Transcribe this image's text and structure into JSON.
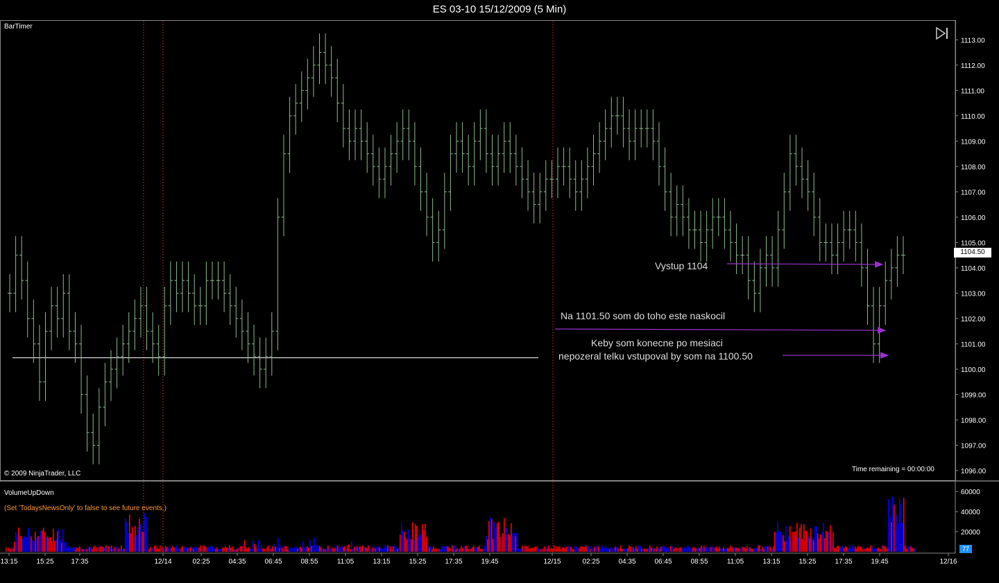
{
  "window": {
    "title": "ES 03-10  15/12/2009 (5 Min)"
  },
  "price_panel": {
    "indicator_label": "BarTimer",
    "copyright": "© 2009 NinjaTrader, LLC",
    "time_remaining": "Time remaining = 00:00:00",
    "last_price_label": "1104.50",
    "play_icon": "skip-forward-icon"
  },
  "volume_panel": {
    "indicator_label": "VolumeUpDown",
    "note": "(Set 'TodaysNewsOnly' to false to see future events.)",
    "last_volume_label": "77"
  },
  "annotations": {
    "exit_text": "Vystup 1104",
    "entry1_text": "Na 1101.50 som do toho este naskocil",
    "entry2_line1": "Keby som konecne po mesiaci",
    "entry2_line2": "nepozeral telku vstupoval by som na 1100.50"
  },
  "colors": {
    "background": "#000000",
    "bars": "#8fbc8f",
    "up_volume": "#0000ff",
    "down_volume": "#ff0000",
    "arrow": "#9932cc",
    "session_line": "#b22222",
    "horizontal_line": "#ffffff"
  },
  "chart_data": [
    {
      "type": "line",
      "description_series": "OHLC bars approximated by closes",
      "x_ticks": [
        "13:15",
        "15:25",
        "17:35",
        "12/14",
        "02:25",
        "04:35",
        "06:45",
        "08:55",
        "11:05",
        "13:15",
        "15:25",
        "17:35",
        "19:45",
        "12/15",
        "02:25",
        "04:35",
        "06:45",
        "08:55",
        "11:05",
        "13:15",
        "15:25",
        "17:35",
        "19:45",
        "12/16"
      ],
      "y_ticks": [
        "1096.00",
        "1097.00",
        "1098.00",
        "1099.00",
        "1100.00",
        "1101.00",
        "1102.00",
        "1103.00",
        "1104.00",
        "1105.00",
        "1106.00",
        "1107.00",
        "1108.00",
        "1109.00",
        "1110.00",
        "1111.00",
        "1112.00",
        "1113.00"
      ],
      "ylim": [
        1096,
        1113.2
      ],
      "horizontal_line_value": 1100.45,
      "session_breaks": [
        "12/14 (two lines)",
        "12/15"
      ],
      "series": [
        {
          "values": [
            1103.0,
            1104.5,
            1103.5,
            1102.0,
            1101.0,
            1099.5,
            1101.5,
            1102.5,
            1102.0,
            1103.0,
            1101.5,
            1101.0,
            1099.0,
            1097.5,
            1097.0,
            1098.5,
            1099.5,
            1100.0,
            1100.5,
            1101.0,
            1101.5,
            1102.0,
            1102.5,
            1101.5,
            1101.0,
            1100.5,
            1102.5,
            1103.5,
            1103.0,
            1103.5,
            1103.0,
            1102.5,
            1102.5,
            1103.5,
            1103.5,
            1103.5,
            1103.0,
            1102.5,
            1102.0,
            1101.5,
            1101.0,
            1100.5,
            1100.0,
            1100.5,
            1101.5,
            1106.0,
            1108.5,
            1110.0,
            1110.5,
            1111.0,
            1111.5,
            1112.0,
            1112.5,
            1112.0,
            1111.5,
            1110.5,
            1109.5,
            1109.0,
            1109.5,
            1109.0,
            1108.5,
            1108.0,
            1107.5,
            1108.0,
            1108.5,
            1109.0,
            1109.5,
            1109.0,
            1108.0,
            1107.0,
            1106.0,
            1105.0,
            1105.5,
            1107.0,
            1108.5,
            1109.0,
            1108.5,
            1108.0,
            1109.0,
            1109.5,
            1108.5,
            1108.0,
            1108.5,
            1109.0,
            1108.5,
            1108.0,
            1107.5,
            1107.0,
            1106.5,
            1107.0,
            1107.5,
            1107.5,
            1108.0,
            1108.0,
            1107.5,
            1107.0,
            1107.5,
            1108.0,
            1108.5,
            1109.0,
            1109.5,
            1110.0,
            1110.0,
            1109.5,
            1109.0,
            1109.5,
            1109.5,
            1109.5,
            1109.0,
            1108.0,
            1107.0,
            1106.0,
            1106.5,
            1106.0,
            1105.5,
            1105.5,
            1105.0,
            1105.5,
            1106.0,
            1106.0,
            1105.5,
            1105.0,
            1104.5,
            1104.5,
            1103.5,
            1103.0,
            1104.0,
            1104.5,
            1104.0,
            1105.5,
            1107.0,
            1108.5,
            1108.0,
            1107.5,
            1107.0,
            1106.0,
            1105.0,
            1105.0,
            1104.5,
            1105.0,
            1105.5,
            1105.5,
            1105.0,
            1104.0,
            1102.5,
            1101.0,
            1102.5,
            1103.5,
            1104.0,
            1104.5,
            1104.5
          ]
        }
      ]
    },
    {
      "type": "bar",
      "y_ticks": [
        "20000",
        "40000",
        "60000"
      ],
      "ylim": [
        0,
        65000
      ],
      "series": [
        {
          "name": "Up volume"
        },
        {
          "name": "Down volume"
        }
      ]
    }
  ]
}
